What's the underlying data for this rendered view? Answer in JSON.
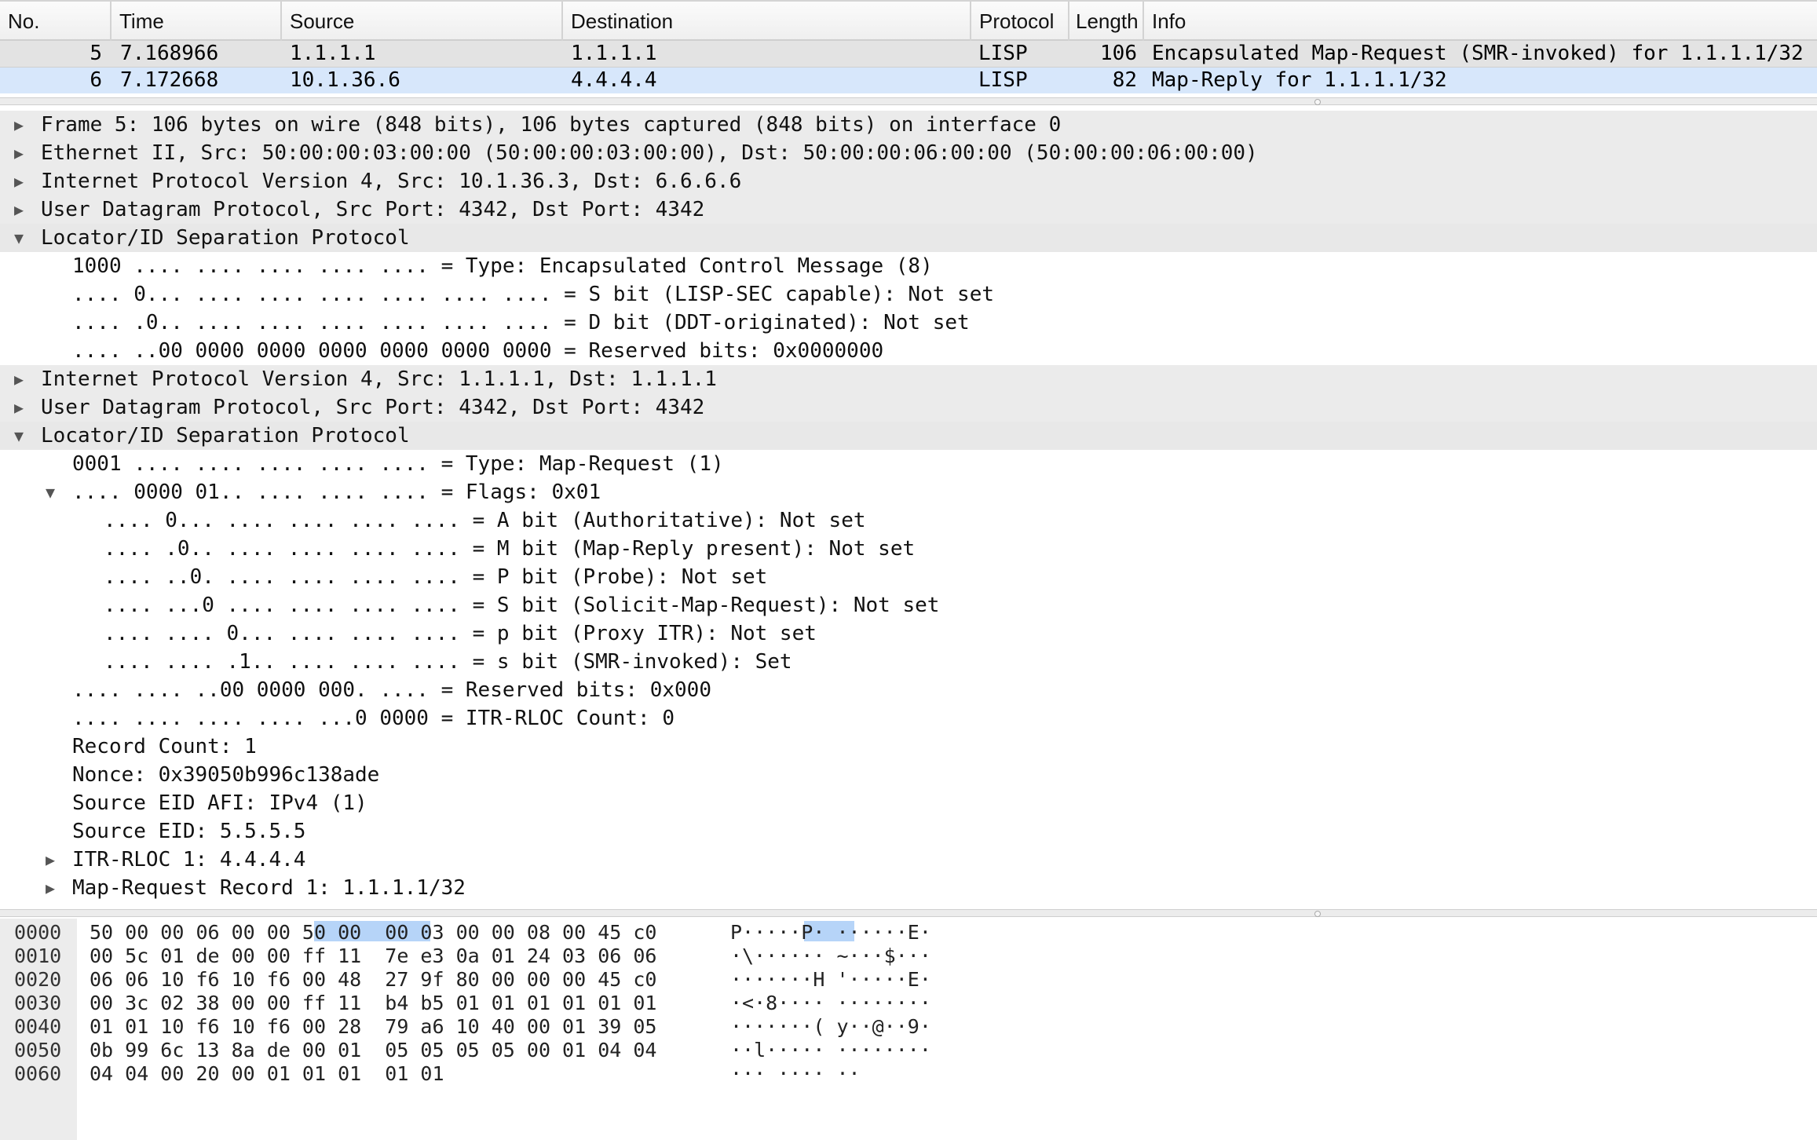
{
  "packet_list": {
    "columns": [
      "No.",
      "Time",
      "Source",
      "Destination",
      "Protocol",
      "Length",
      "Info"
    ],
    "rows": [
      {
        "no": "5",
        "time": "7.168966",
        "source": "1.1.1.1",
        "destination": "1.1.1.1",
        "protocol": "LISP",
        "length": "106",
        "info": "Encapsulated Map-Request (SMR-invoked) for 1.1.1.1/32"
      },
      {
        "no": "6",
        "time": "7.172668",
        "source": "10.1.36.6",
        "destination": "4.4.4.4",
        "protocol": "LISP",
        "length": "82",
        "info": "Map-Reply for 1.1.1.1/32"
      }
    ]
  },
  "details": [
    {
      "level": 0,
      "toggle": "collapsed",
      "text": "Frame 5: 106 bytes on wire (848 bits), 106 bytes captured (848 bits) on interface 0"
    },
    {
      "level": 0,
      "toggle": "collapsed",
      "text": "Ethernet II, Src: 50:00:00:03:00:00 (50:00:00:03:00:00), Dst: 50:00:00:06:00:00 (50:00:00:06:00:00)"
    },
    {
      "level": 0,
      "toggle": "collapsed",
      "text": "Internet Protocol Version 4, Src: 10.1.36.3, Dst: 6.6.6.6"
    },
    {
      "level": 0,
      "toggle": "collapsed",
      "text": "User Datagram Protocol, Src Port: 4342, Dst Port: 4342"
    },
    {
      "level": 0,
      "toggle": "expanded",
      "text": "Locator/ID Separation Protocol"
    },
    {
      "level": 1,
      "toggle": "none",
      "text": "1000 .... .... .... .... .... = Type: Encapsulated Control Message (8)"
    },
    {
      "level": 1,
      "toggle": "none",
      "text": ".... 0... .... .... .... .... .... .... = S bit (LISP-SEC capable): Not set"
    },
    {
      "level": 1,
      "toggle": "none",
      "text": ".... .0.. .... .... .... .... .... .... = D bit (DDT-originated): Not set"
    },
    {
      "level": 1,
      "toggle": "none",
      "text": ".... ..00 0000 0000 0000 0000 0000 0000 = Reserved bits: 0x0000000"
    },
    {
      "level": 0,
      "toggle": "collapsed",
      "text": "Internet Protocol Version 4, Src: 1.1.1.1, Dst: 1.1.1.1"
    },
    {
      "level": 0,
      "toggle": "collapsed",
      "text": "User Datagram Protocol, Src Port: 4342, Dst Port: 4342"
    },
    {
      "level": 0,
      "toggle": "expanded",
      "text": "Locator/ID Separation Protocol"
    },
    {
      "level": 1,
      "toggle": "none",
      "text": "0001 .... .... .... .... .... = Type: Map-Request (1)"
    },
    {
      "level": 1,
      "toggle": "expanded",
      "text": ".... 0000 01.. .... .... .... = Flags: 0x01"
    },
    {
      "level": 2,
      "toggle": "none",
      "text": ".... 0... .... .... .... .... = A bit (Authoritative): Not set"
    },
    {
      "level": 2,
      "toggle": "none",
      "text": ".... .0.. .... .... .... .... = M bit (Map-Reply present): Not set"
    },
    {
      "level": 2,
      "toggle": "none",
      "text": ".... ..0. .... .... .... .... = P bit (Probe): Not set"
    },
    {
      "level": 2,
      "toggle": "none",
      "text": ".... ...0 .... .... .... .... = S bit (Solicit-Map-Request): Not set"
    },
    {
      "level": 2,
      "toggle": "none",
      "text": ".... .... 0... .... .... .... = p bit (Proxy ITR): Not set"
    },
    {
      "level": 2,
      "toggle": "none",
      "text": ".... .... .1.. .... .... .... = s bit (SMR-invoked): Set"
    },
    {
      "level": 1,
      "toggle": "none",
      "text": ".... .... ..00 0000 000. .... = Reserved bits: 0x000"
    },
    {
      "level": 1,
      "toggle": "none",
      "text": ".... .... .... .... ...0 0000 = ITR-RLOC Count: 0"
    },
    {
      "level": 1,
      "toggle": "none",
      "text": "Record Count: 1"
    },
    {
      "level": 1,
      "toggle": "none",
      "text": "Nonce: 0x39050b996c138ade"
    },
    {
      "level": 1,
      "toggle": "none",
      "text": "Source EID AFI: IPv4 (1)"
    },
    {
      "level": 1,
      "toggle": "none",
      "text": "Source EID: 5.5.5.5"
    },
    {
      "level": 1,
      "toggle": "collapsed",
      "text": "ITR-RLOC 1: 4.4.4.4"
    },
    {
      "level": 1,
      "toggle": "collapsed",
      "text": "Map-Request Record 1: 1.1.1.1/32"
    }
  ],
  "hex": [
    {
      "offset": "0000",
      "bytes": "50 00 00 06 00 00 50 00  00 03 00 00 08 00 45 c0",
      "ascii": "P·····P· ······E·"
    },
    {
      "offset": "0010",
      "bytes": "00 5c 01 de 00 00 ff 11  7e e3 0a 01 24 03 06 06",
      "ascii": "·\\······ ~···$···"
    },
    {
      "offset": "0020",
      "bytes": "06 06 10 f6 10 f6 00 48  27 9f 80 00 00 00 45 c0",
      "ascii": "·······H '·····E·"
    },
    {
      "offset": "0030",
      "bytes": "00 3c 02 38 00 00 ff 11  b4 b5 01 01 01 01 01 01",
      "ascii": "·<·8···· ········"
    },
    {
      "offset": "0040",
      "bytes": "01 01 10 f6 10 f6 00 28  79 a6 10 40 00 01 39 05",
      "ascii": "·······( y··@··9·"
    },
    {
      "offset": "0050",
      "bytes": "0b 99 6c 13 8a de 00 01  05 05 05 05 00 01 04 04",
      "ascii": "··l····· ········"
    },
    {
      "offset": "0060",
      "bytes": "04 04 00 20 00 01 01 01  01 01",
      "ascii": "··· ···· ··"
    }
  ],
  "icons": {
    "collapsed": "triangle-right-icon",
    "expanded": "triangle-down-icon"
  },
  "colors": {
    "selected_row": "#e3e3e3",
    "alt_row": "#d7e7fb",
    "hex_highlight": "#b6d4f8"
  }
}
